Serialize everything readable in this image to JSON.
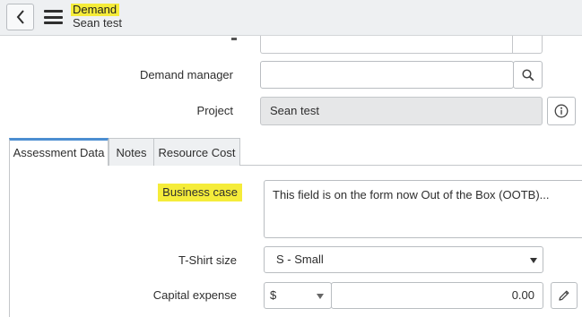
{
  "header": {
    "record_type": "Demand",
    "record_name": "Sean test",
    "back_icon": "chevron-left-icon",
    "menu_icon": "hamburger-icon"
  },
  "fields": {
    "demand_manager": {
      "label": "Demand manager",
      "value": "",
      "lookup_icon": "search-icon"
    },
    "project": {
      "label": "Project",
      "value": "Sean test",
      "info_icon": "info-icon"
    }
  },
  "tabs": [
    {
      "label": "Assessment Data",
      "active": true
    },
    {
      "label": "Notes",
      "active": false
    },
    {
      "label": "Resource Cost",
      "active": false
    }
  ],
  "assessment": {
    "business_case": {
      "label": "Business case",
      "value": "This field is on the form now Out of the Box (OOTB)..."
    },
    "tshirt_size": {
      "label": "T-Shirt size",
      "value": "S - Small"
    },
    "capital_expense": {
      "label": "Capital expense",
      "currency": "$",
      "amount": "0.00",
      "edit_icon": "pencil-icon"
    }
  },
  "colors": {
    "highlight": "#f5ec3a",
    "active_tab_accent": "#4c8ed1",
    "header_bg": "#eef0f2",
    "readonly_bg": "#e6e7e8"
  }
}
